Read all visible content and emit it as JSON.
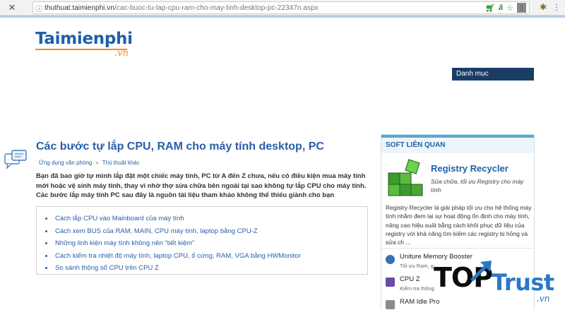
{
  "browser": {
    "url_host": "thuthuat.taimienphi.vn",
    "url_path": "/cac-buoc-tu-lap-cpu-ram-cho-may-tinh-desktop-pc-22347n.aspx"
  },
  "site": {
    "logo_text": "Taimienphi",
    "logo_suffix": ".vn",
    "category_label": "Danh mục"
  },
  "article": {
    "title": "Các bước tự lắp CPU, RAM cho máy tính desktop, PC",
    "breadcrumb": [
      "Ứng dụng văn phòng",
      "Thủ thuật khác"
    ],
    "breadcrumb_sep": "»",
    "intro": "Bạn đã bao giờ tự mình lắp đặt một chiếc máy tính, PC từ A đến Z chưa, nếu có điều kiện mua máy tính mới hoặc vệ sinh máy tính, thay vì nhờ thợ sửa chữa bên ngoài tại sao không tự lắp CPU cho máy tính. Các bước lắp máy tính PC sau đây là nguồn tài liệu tham khảo không thể thiếu giành cho bạn",
    "toc": [
      "Cách lắp CPU vào Mainboard của máy tính",
      "Cách xem BUS của RAM, MAIN, CPU máy tính, laptop bằng CPU-Z",
      "Những linh kiện máy tính không nên \"tiết kiệm\"",
      "Cách kiểm tra nhiệt độ máy tính, laptop CPU, ổ cứng, RAM, VGA bằng HWMonitor",
      "So sánh thông số CPU trên CPU Z"
    ]
  },
  "sidebar": {
    "heading": "SOFT LIÊN QUAN",
    "featured": {
      "title": "Registry Recycler",
      "subtitle": "Sửa chữa, tối ưu Registry cho máy tính",
      "description": "Registry Recycler là giải pháp tối ưu cho hệ thống máy tính nhằm đem lại sự hoạt động ổn định cho máy tính, nâng cao hiệu suất bằng cách khôi phục dữ liệu của registry với khả năng tìm kiếm các registry bị hỏng và sửa ch ..."
    },
    "items": [
      {
        "name": "Uniture Memory Booster",
        "desc": "Tối ưu Ram, g"
      },
      {
        "name": "CPU Z",
        "desc": "Kiểm tra thông"
      },
      {
        "name": "RAM Idle Pro",
        "desc": ""
      }
    ]
  },
  "watermark": {
    "top": "TOP",
    "trust": "Trust",
    "vn": ".vn"
  },
  "colors": {
    "link": "#2a5ea8",
    "accent": "#f08a1c",
    "nav_dark": "#1b3c65"
  }
}
